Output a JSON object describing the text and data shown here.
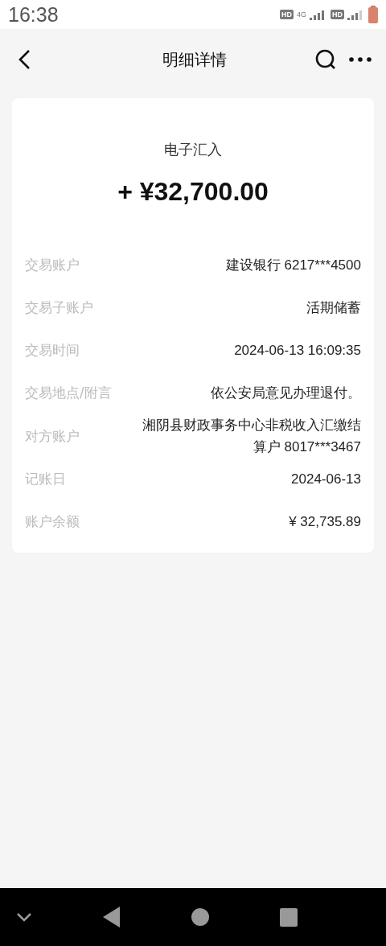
{
  "status_bar": {
    "time": "16:38",
    "badges": [
      "HD",
      "4G",
      "HD"
    ]
  },
  "header": {
    "title": "明细详情"
  },
  "summary": {
    "type": "电子汇入",
    "amount": "+ ¥32,700.00"
  },
  "details": [
    {
      "label": "交易账户",
      "value": "建设银行 6217***4500"
    },
    {
      "label": "交易子账户",
      "value": "活期储蓄"
    },
    {
      "label": "交易时间",
      "value": "2024-06-13 16:09:35"
    },
    {
      "label": "交易地点/附言",
      "value": "依公安局意见办理退付。"
    },
    {
      "label": "对方账户",
      "value": "湘阴县财政事务中心非税收入汇缴结算户 8017***3467"
    },
    {
      "label": "记账日",
      "value": "2024-06-13"
    },
    {
      "label": "账户余额",
      "value": "¥ 32,735.89"
    }
  ]
}
